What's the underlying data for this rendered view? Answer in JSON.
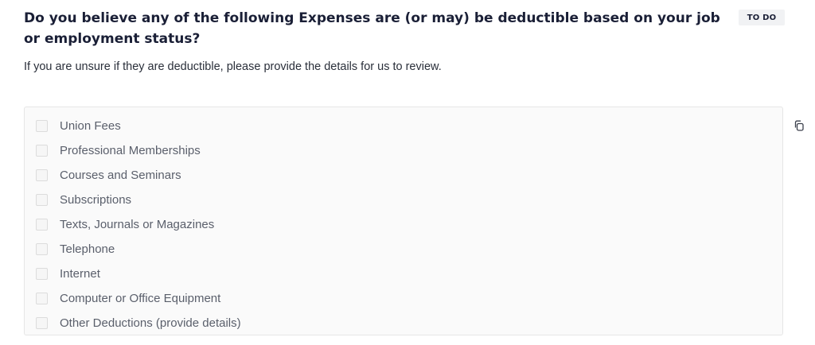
{
  "question": {
    "title": "Do you believe any of the following Expenses are (or may) be deductible based on your job or employment status?",
    "status_badge": "TO DO",
    "subtitle": "If you are unsure if they are deductible, please provide the details for us to review."
  },
  "options": [
    {
      "label": "Union Fees",
      "checked": false
    },
    {
      "label": "Professional Memberships",
      "checked": false
    },
    {
      "label": "Courses and Seminars",
      "checked": false
    },
    {
      "label": "Subscriptions",
      "checked": false
    },
    {
      "label": "Texts, Journals or Magazines",
      "checked": false
    },
    {
      "label": "Telephone",
      "checked": false
    },
    {
      "label": "Internet",
      "checked": false
    },
    {
      "label": "Computer or Office Equipment",
      "checked": false
    },
    {
      "label": "Other Deductions (provide details)",
      "checked": false
    }
  ],
  "actions": {
    "copy_icon": "copy-icon"
  }
}
